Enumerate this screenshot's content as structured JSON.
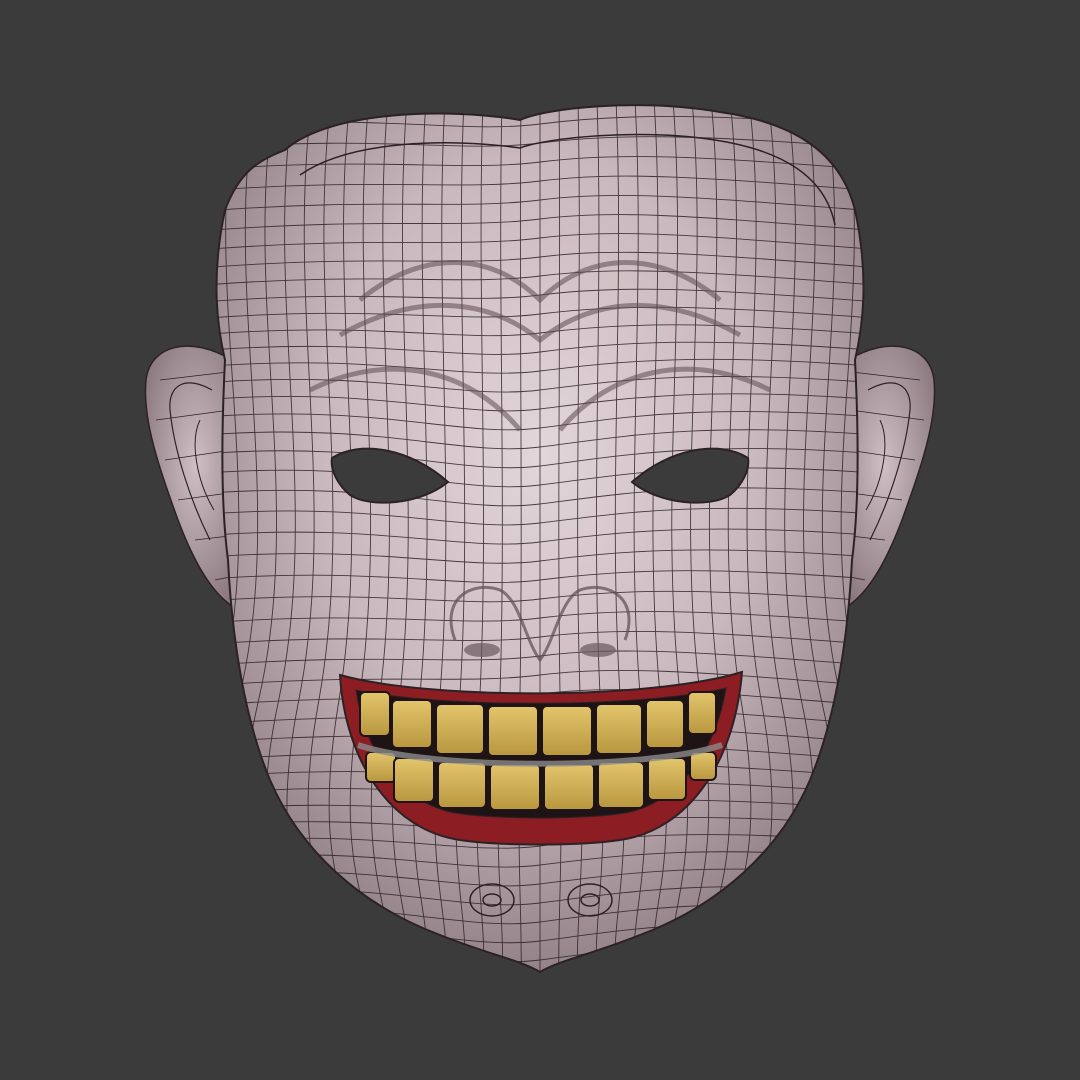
{
  "scene": {
    "subject": "wireframe-mask-3d-model",
    "colors": {
      "background": "#3b3b3b",
      "skin_light": "#ddd0d4",
      "skin_mid": "#b9a8ad",
      "skin_dark": "#7e6d73",
      "wire": "#2c2226",
      "lips": "#8c1d22",
      "teeth": "#d4b460",
      "eye_holes": "#3b3b3b"
    }
  }
}
